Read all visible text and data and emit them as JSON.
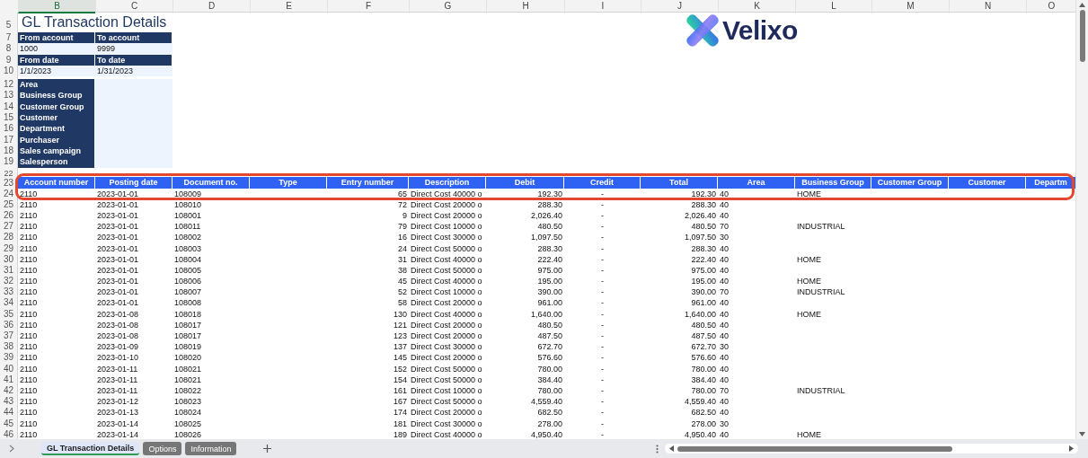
{
  "column_headers": [
    {
      "label": "B",
      "selected": true
    },
    {
      "label": "C",
      "selected": false
    },
    {
      "label": "D",
      "selected": false
    },
    {
      "label": "E",
      "selected": false
    },
    {
      "label": "F",
      "selected": false
    },
    {
      "label": "G",
      "selected": false
    },
    {
      "label": "H",
      "selected": false
    },
    {
      "label": "I",
      "selected": false
    },
    {
      "label": "J",
      "selected": false
    },
    {
      "label": "K",
      "selected": false
    },
    {
      "label": "L",
      "selected": false
    },
    {
      "label": "M",
      "selected": false
    },
    {
      "label": "N",
      "selected": false
    },
    {
      "label": "O",
      "selected": false
    }
  ],
  "title": {
    "row": "5",
    "text": "GL Transaction Details"
  },
  "logo": {
    "text": "Velixo"
  },
  "parameters": [
    {
      "label_row": "7",
      "value_row": "8",
      "fields": [
        {
          "label": "From account",
          "value": "1000"
        },
        {
          "label": "To account",
          "value": "9999"
        }
      ]
    },
    {
      "label_row": "9",
      "value_row": "10",
      "fields": [
        {
          "label": "From date",
          "value": "1/1/2023"
        },
        {
          "label": "To date",
          "value": "1/31/2023"
        }
      ]
    }
  ],
  "filters": [
    {
      "row": "12",
      "label": "Area"
    },
    {
      "row": "13",
      "label": "Business Group"
    },
    {
      "row": "14",
      "label": "Customer Group"
    },
    {
      "row": "15",
      "label": "Customer"
    },
    {
      "row": "16",
      "label": "Department"
    },
    {
      "row": "17",
      "label": "Purchaser"
    },
    {
      "row": "18",
      "label": "Sales campaign"
    },
    {
      "row": "19",
      "label": "Salesperson"
    }
  ],
  "spacer_row": "22",
  "table": {
    "header_row": "23",
    "columns": [
      "Account number",
      "Posting date",
      "Document no.",
      "Type",
      "Entry number",
      "Description",
      "Debit",
      "Credit",
      "Total",
      "Area",
      "Business Group",
      "Customer Group",
      "Customer",
      "Departm"
    ],
    "rows": [
      {
        "n": "24",
        "account": "2110",
        "date": "2023-01-01",
        "doc": "108009",
        "entry": "65",
        "desc": "Direct Cost 40000 o",
        "debit": "192.30",
        "credit": "-",
        "total": "192.30",
        "area": "40",
        "group": "HOME"
      },
      {
        "n": "25",
        "account": "2110",
        "date": "2023-01-01",
        "doc": "108010",
        "entry": "72",
        "desc": "Direct Cost 20000 o",
        "debit": "288.30",
        "credit": "-",
        "total": "288.30",
        "area": "40"
      },
      {
        "n": "26",
        "account": "2110",
        "date": "2023-01-01",
        "doc": "108001",
        "entry": "9",
        "desc": "Direct Cost 20000 o",
        "debit": "2,026.40",
        "credit": "-",
        "total": "2,026.40",
        "area": "40"
      },
      {
        "n": "27",
        "account": "2110",
        "date": "2023-01-01",
        "doc": "108011",
        "entry": "79",
        "desc": "Direct Cost 10000 o",
        "debit": "480.50",
        "credit": "-",
        "total": "480.50",
        "area": "70",
        "group": "INDUSTRIAL"
      },
      {
        "n": "28",
        "account": "2110",
        "date": "2023-01-01",
        "doc": "108002",
        "entry": "16",
        "desc": "Direct Cost 30000 o",
        "debit": "1,097.50",
        "credit": "-",
        "total": "1,097.50",
        "area": "30"
      },
      {
        "n": "29",
        "account": "2110",
        "date": "2023-01-01",
        "doc": "108003",
        "entry": "24",
        "desc": "Direct Cost 50000 o",
        "debit": "288.30",
        "credit": "-",
        "total": "288.30",
        "area": "40"
      },
      {
        "n": "30",
        "account": "2110",
        "date": "2023-01-01",
        "doc": "108004",
        "entry": "31",
        "desc": "Direct Cost 40000 o",
        "debit": "222.40",
        "credit": "-",
        "total": "222.40",
        "area": "40",
        "group": "HOME"
      },
      {
        "n": "31",
        "account": "2110",
        "date": "2023-01-01",
        "doc": "108005",
        "entry": "38",
        "desc": "Direct Cost 50000 o",
        "debit": "975.00",
        "credit": "-",
        "total": "975.00",
        "area": "40"
      },
      {
        "n": "32",
        "account": "2110",
        "date": "2023-01-01",
        "doc": "108006",
        "entry": "45",
        "desc": "Direct Cost 40000 o",
        "debit": "195.00",
        "credit": "-",
        "total": "195.00",
        "area": "40",
        "group": "HOME"
      },
      {
        "n": "33",
        "account": "2110",
        "date": "2023-01-01",
        "doc": "108007",
        "entry": "52",
        "desc": "Direct Cost 10000 o",
        "debit": "390.00",
        "credit": "-",
        "total": "390.00",
        "area": "70",
        "group": "INDUSTRIAL"
      },
      {
        "n": "34",
        "account": "2110",
        "date": "2023-01-01",
        "doc": "108008",
        "entry": "58",
        "desc": "Direct Cost 20000 o",
        "debit": "961.00",
        "credit": "-",
        "total": "961.00",
        "area": "40"
      },
      {
        "n": "35",
        "account": "2110",
        "date": "2023-01-08",
        "doc": "108018",
        "entry": "130",
        "desc": "Direct Cost 40000 o",
        "debit": "1,640.00",
        "credit": "-",
        "total": "1,640.00",
        "area": "40",
        "group": "HOME"
      },
      {
        "n": "36",
        "account": "2110",
        "date": "2023-01-08",
        "doc": "108017",
        "entry": "121",
        "desc": "Direct Cost 20000 o",
        "debit": "480.50",
        "credit": "-",
        "total": "480.50",
        "area": "40"
      },
      {
        "n": "37",
        "account": "2110",
        "date": "2023-01-08",
        "doc": "108017",
        "entry": "123",
        "desc": "Direct Cost 20000 o",
        "debit": "487.50",
        "credit": "-",
        "total": "487.50",
        "area": "40"
      },
      {
        "n": "38",
        "account": "2110",
        "date": "2023-01-09",
        "doc": "108019",
        "entry": "137",
        "desc": "Direct Cost 30000 o",
        "debit": "672.70",
        "credit": "-",
        "total": "672.70",
        "area": "30"
      },
      {
        "n": "39",
        "account": "2110",
        "date": "2023-01-10",
        "doc": "108020",
        "entry": "145",
        "desc": "Direct Cost 20000 o",
        "debit": "576.60",
        "credit": "-",
        "total": "576.60",
        "area": "40"
      },
      {
        "n": "40",
        "account": "2110",
        "date": "2023-01-11",
        "doc": "108021",
        "entry": "152",
        "desc": "Direct Cost 50000 o",
        "debit": "780.00",
        "credit": "-",
        "total": "780.00",
        "area": "40"
      },
      {
        "n": "41",
        "account": "2110",
        "date": "2023-01-11",
        "doc": "108021",
        "entry": "154",
        "desc": "Direct Cost 50000 o",
        "debit": "384.40",
        "credit": "-",
        "total": "384.40",
        "area": "40"
      },
      {
        "n": "42",
        "account": "2110",
        "date": "2023-01-11",
        "doc": "108022",
        "entry": "161",
        "desc": "Direct Cost 10000 o",
        "debit": "780.00",
        "credit": "-",
        "total": "780.00",
        "area": "70",
        "group": "INDUSTRIAL"
      },
      {
        "n": "43",
        "account": "2110",
        "date": "2023-01-12",
        "doc": "108023",
        "entry": "167",
        "desc": "Direct Cost 50000 o",
        "debit": "4,559.40",
        "credit": "-",
        "total": "4,559.40",
        "area": "40"
      },
      {
        "n": "44",
        "account": "2110",
        "date": "2023-01-13",
        "doc": "108024",
        "entry": "174",
        "desc": "Direct Cost 20000 o",
        "debit": "682.50",
        "credit": "-",
        "total": "682.50",
        "area": "40"
      },
      {
        "n": "45",
        "account": "2110",
        "date": "2023-01-14",
        "doc": "108025",
        "entry": "181",
        "desc": "Direct Cost 30000 o",
        "debit": "278.00",
        "credit": "-",
        "total": "278.00",
        "area": "30"
      },
      {
        "n": "46",
        "account": "2110",
        "date": "2023-01-14",
        "doc": "108026",
        "entry": "189",
        "desc": "Direct Cost 40000 o",
        "debit": "4,950.40",
        "credit": "-",
        "total": "4,950.40",
        "area": "40",
        "group": "HOME"
      }
    ]
  },
  "sheet_tabs": [
    {
      "label": "GL Transaction Details",
      "selected": true
    },
    {
      "label": "Options",
      "selected": false
    },
    {
      "label": "Information",
      "selected": false
    }
  ]
}
